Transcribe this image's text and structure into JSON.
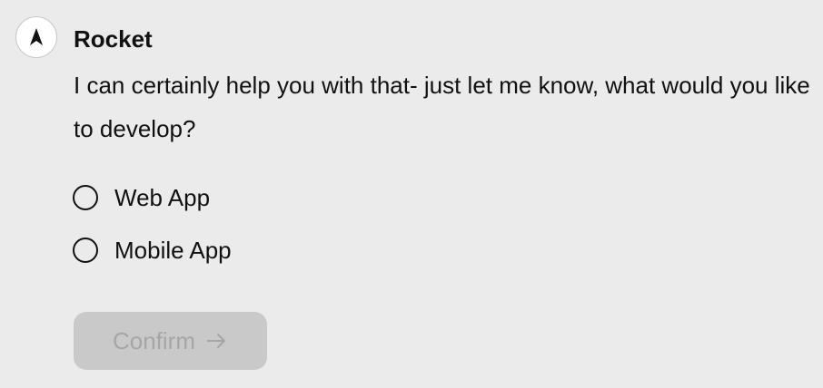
{
  "assistant": {
    "name": "Rocket",
    "avatar_icon": "rocket-logo-icon"
  },
  "message": {
    "text": "I can certainly help you with that- just let me know, what would you like to develop?"
  },
  "options": [
    {
      "label": "Web App",
      "selected": false
    },
    {
      "label": "Mobile App",
      "selected": false
    }
  ],
  "confirm_button": {
    "label": "Confirm",
    "icon": "arrow-right-icon",
    "disabled": true
  },
  "colors": {
    "background": "#ebebeb",
    "text": "#111111",
    "button_disabled_bg": "#c9c9c9",
    "button_disabled_text": "#a6a6a6"
  }
}
